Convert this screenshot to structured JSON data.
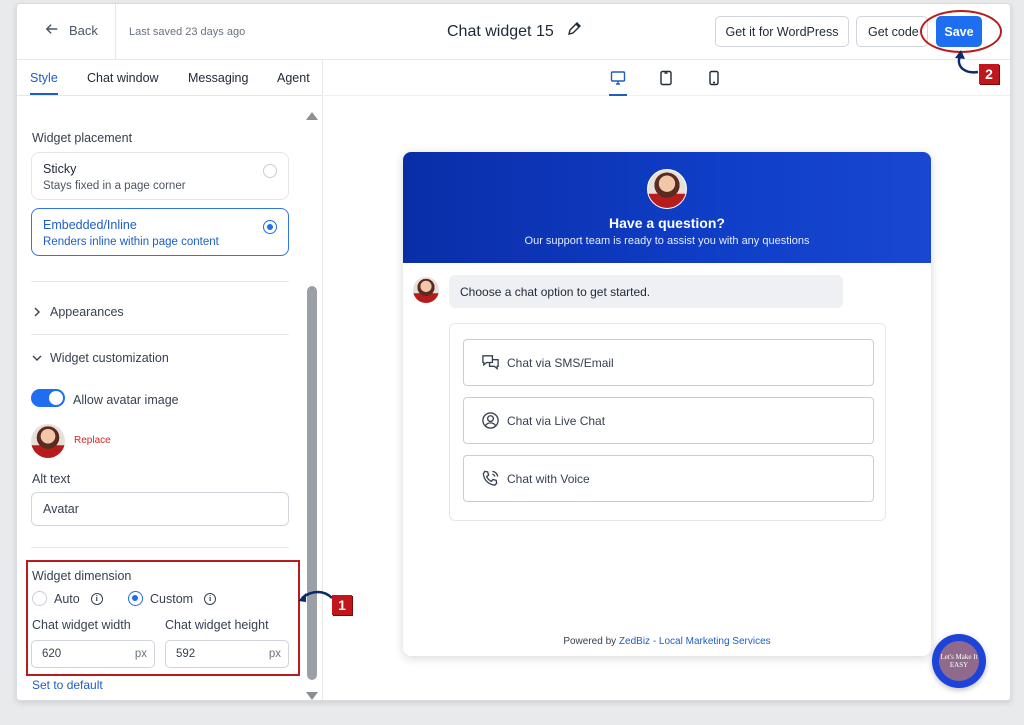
{
  "topbar": {
    "back_label": "Back",
    "saved_text": "Last saved 23 days ago",
    "title": "Chat widget 15",
    "wordpress_button": "Get it for WordPress",
    "code_button": "Get code",
    "save_button": "Save"
  },
  "tabs": [
    "Style",
    "Chat window",
    "Messaging",
    "Agent"
  ],
  "active_tab": "Style",
  "placement": {
    "label": "Widget placement",
    "options": [
      {
        "title": "Sticky",
        "desc": "Stays fixed in a page corner",
        "selected": false
      },
      {
        "title": "Embedded/Inline",
        "desc": "Renders inline within page content",
        "selected": true
      }
    ]
  },
  "sections": {
    "appearances": "Appearances",
    "customization": "Widget customization"
  },
  "avatar_toggle": {
    "label": "Allow avatar image",
    "on": true
  },
  "replace_link": "Replace",
  "alt_text": {
    "label": "Alt text",
    "value": "Avatar"
  },
  "dimension": {
    "label": "Widget dimension",
    "auto": "Auto",
    "custom": "Custom",
    "selected": "Custom",
    "width_label": "Chat widget width",
    "height_label": "Chat widget height",
    "width_value": "620",
    "height_value": "592",
    "unit": "px",
    "default_link": "Set to default"
  },
  "preview": {
    "header_title": "Have a question?",
    "header_sub": "Our support team is ready to assist you with any questions",
    "message": "Choose a chat option to get started.",
    "options": [
      "Chat via SMS/Email",
      "Chat via Live Chat",
      "Chat with Voice"
    ],
    "powered_by": "Powered by",
    "powered_link": "ZedBiz - Local Marketing Services"
  },
  "fab_text": "Let's Make It EASY",
  "callouts": [
    "1",
    "2"
  ],
  "colors": {
    "accent": "#1d6ef1",
    "header": "#0f3ec7",
    "callout": "#c0161c"
  }
}
